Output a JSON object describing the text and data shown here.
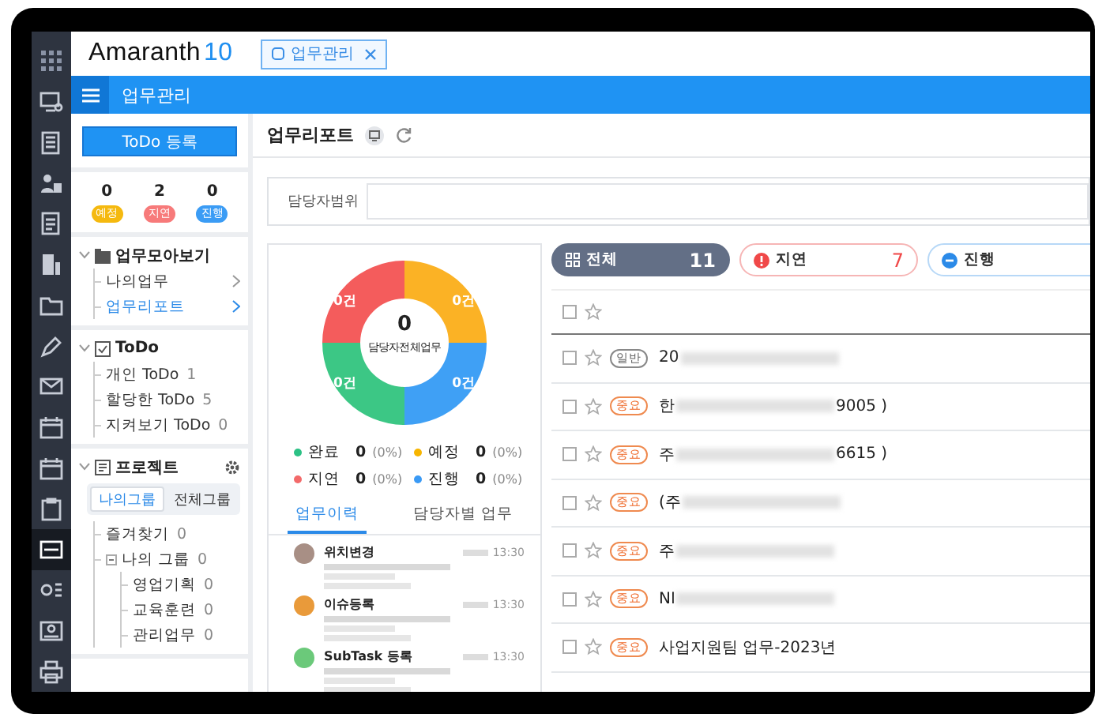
{
  "rail": {
    "items": [
      {
        "kind": "apps",
        "selected": false
      },
      {
        "kind": "monitor",
        "selected": false
      },
      {
        "kind": "calculator",
        "selected": false
      },
      {
        "kind": "person",
        "selected": false
      },
      {
        "kind": "document",
        "selected": false
      },
      {
        "kind": "building",
        "selected": false
      },
      {
        "kind": "folder",
        "selected": false
      },
      {
        "kind": "pen",
        "selected": false
      },
      {
        "kind": "mail",
        "selected": false
      },
      {
        "kind": "calendar",
        "selected": false
      },
      {
        "kind": "calendar",
        "selected": false
      },
      {
        "kind": "clipboard",
        "selected": false
      },
      {
        "kind": "board",
        "selected": true
      },
      {
        "kind": "list",
        "selected": false
      },
      {
        "kind": "card",
        "selected": false
      },
      {
        "kind": "printer",
        "selected": false
      }
    ]
  },
  "header": {
    "logo": {
      "text": "Amaranth",
      "version": "10"
    },
    "tabs": [
      {
        "label": "업무관리",
        "selected": true
      }
    ]
  },
  "menu_bar": {
    "title": "업무관리"
  },
  "sidebar": {
    "register_button": "ToDo 등록",
    "counts": [
      {
        "value": "0",
        "label": "예정",
        "color": "#f5b90f"
      },
      {
        "value": "2",
        "label": "지연",
        "color": "#f77a7a"
      },
      {
        "value": "0",
        "label": "진행",
        "color": "#3b9cf5"
      }
    ],
    "sections": [
      {
        "title": "업무모아보기",
        "kind": "folder",
        "expanded": true,
        "items": [
          {
            "label": "나의업무",
            "selected": false
          },
          {
            "label": "업무리포트",
            "selected": true
          }
        ]
      },
      {
        "title": "ToDo",
        "kind": "todo",
        "expanded": true,
        "items": [
          {
            "label": "개인 ToDo",
            "count": "1",
            "selected": false
          },
          {
            "label": "할당한 ToDo",
            "count": "5",
            "selected": false
          },
          {
            "label": "지켜보기 ToDo",
            "count": "0",
            "selected": false
          }
        ]
      },
      {
        "title": "프로젝트",
        "kind": "project",
        "expanded": true,
        "group_tabs": [
          {
            "label": "나의그룹",
            "selected": true
          },
          {
            "label": "전체그룹",
            "selected": false
          }
        ],
        "items": [
          {
            "label": "즐겨찾기",
            "count": "0",
            "selected": false
          },
          {
            "label": "나의 그룹",
            "count": "0",
            "selected": false,
            "expanded": true,
            "children": [
              {
                "label": "영업기획",
                "count": "0",
                "selected": false
              },
              {
                "label": "교육훈련",
                "count": "0",
                "selected": false
              },
              {
                "label": "관리업무",
                "count": "0",
                "selected": false
              }
            ]
          }
        ]
      }
    ]
  },
  "main": {
    "title": "업무리포트",
    "filter": {
      "label": "담당자범위"
    },
    "chart": {
      "total": "0",
      "caption": "담당자전체업무",
      "segments": [
        {
          "label": "0건",
          "color": "#f45c5c"
        },
        {
          "label": "0건",
          "color": "#fbb225"
        },
        {
          "label": "0건",
          "color": "#3cc785"
        },
        {
          "label": "0건",
          "color": "#3fa0f5"
        }
      ],
      "legend": [
        {
          "name": "완료",
          "count": "0",
          "percent": "(0%)",
          "color": "#2cc185"
        },
        {
          "name": "예정",
          "count": "0",
          "percent": "(0%)",
          "color": "#f7b500"
        },
        {
          "name": "지연",
          "count": "0",
          "percent": "(0%)",
          "color": "#f36a6a"
        },
        {
          "name": "진행",
          "count": "0",
          "percent": "(0%)",
          "color": "#3a9af5"
        }
      ]
    },
    "tabs": [
      {
        "label": "업무이력",
        "selected": true
      },
      {
        "label": "담당자별 업무",
        "selected": false
      }
    ],
    "history": [
      {
        "title": "위치변경",
        "time": "13:30",
        "color": "#a88f85"
      },
      {
        "title": "이슈등록",
        "time": "13:30",
        "color": "#e99a3a"
      },
      {
        "title": "SubTask 등록",
        "time": "13:30",
        "color": "#6bc97a"
      }
    ]
  },
  "task_list": {
    "filters": [
      {
        "label": "전체",
        "count": "11",
        "kind": "all",
        "selected": true
      },
      {
        "label": "지연",
        "count": "7",
        "kind": "delay",
        "selected": false
      },
      {
        "label": "진행",
        "kind": "progress",
        "selected": false
      }
    ],
    "header_row": {
      "checked": false
    },
    "rows": [
      {
        "checked": false,
        "tag": "일반",
        "kind": "normal",
        "title": "20",
        "blurred": true
      },
      {
        "checked": false,
        "tag": "중요",
        "kind": "important",
        "title": "한",
        "blurred": true,
        "title_end": "9005 )"
      },
      {
        "checked": false,
        "tag": "중요",
        "kind": "important",
        "title": "주",
        "blurred": true,
        "title_end": "6615 )"
      },
      {
        "checked": false,
        "tag": "중요",
        "kind": "important",
        "title": "(주",
        "blurred": true
      },
      {
        "checked": false,
        "tag": "중요",
        "kind": "important",
        "title": "주",
        "blurred": true
      },
      {
        "checked": false,
        "tag": "중요",
        "kind": "important",
        "title": "NI",
        "blurred": true
      },
      {
        "checked": false,
        "tag": "중요",
        "kind": "important",
        "title": "사업지원팀 업무-2023년",
        "blurred": false
      }
    ]
  }
}
